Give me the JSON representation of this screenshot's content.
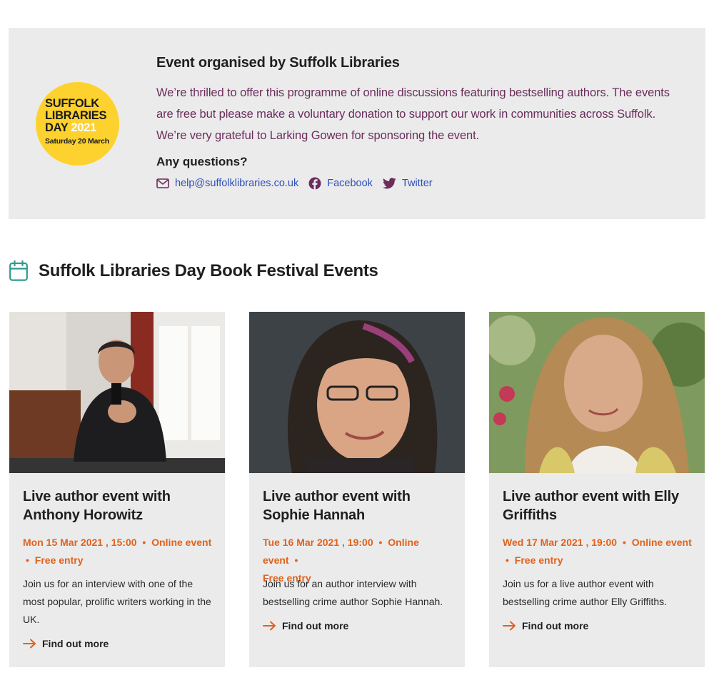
{
  "organiser": {
    "logo": {
      "line1": "SUFFOLK",
      "line2": "LIBRARIES",
      "line3": "DAY",
      "year": "2021",
      "date": "Saturday 20 March"
    },
    "title": "Event organised by Suffolk Libraries",
    "description": "We’re thrilled to offer this programme of online discussions featuring bestselling authors. The events are free but please make a voluntary donation to support our work in communities across Suffolk. We’re very grateful to Larking Gowen for sponsoring the event.",
    "questions_label": "Any questions?",
    "contacts": [
      {
        "icon": "mail-icon",
        "label": "help@suffolklibraries.co.uk"
      },
      {
        "icon": "facebook-icon",
        "label": "Facebook"
      },
      {
        "icon": "twitter-icon",
        "label": "Twitter"
      }
    ]
  },
  "section": {
    "icon": "calendar-icon",
    "title": "Suffolk Libraries Day Book Festival Events"
  },
  "events": [
    {
      "title": "Live author event with Anthony Horowitz",
      "date": "Mon 15 Mar 2021 , 15:00",
      "type": "Online event",
      "price": "Free entry",
      "description": "Join us for an interview with one of the most popular, prolific writers working in the UK.",
      "link": "Find out more"
    },
    {
      "title": "Live author event with Sophie Hannah",
      "date": "Tue 16 Mar 2021 , 19:00",
      "type": "Online event",
      "price": "Free entry",
      "description": "Join us for an author interview with bestselling crime author Sophie Hannah.",
      "link": "Find out more"
    },
    {
      "title": "Live author event with Elly Griffiths",
      "date": "Wed 17 Mar 2021 , 19:00",
      "type": "Online event",
      "price": "Free entry",
      "description": "Join us for a live author event with bestselling crime author Elly Griffiths.",
      "link": "Find out more"
    }
  ],
  "colors": {
    "panel": "#ebebeb",
    "accent": "#e0621c",
    "description_text": "#6b2d5c",
    "link": "#2c4fb6",
    "logo_yellow": "#fdd22e",
    "calendar_icon": "#2f9b8f"
  }
}
